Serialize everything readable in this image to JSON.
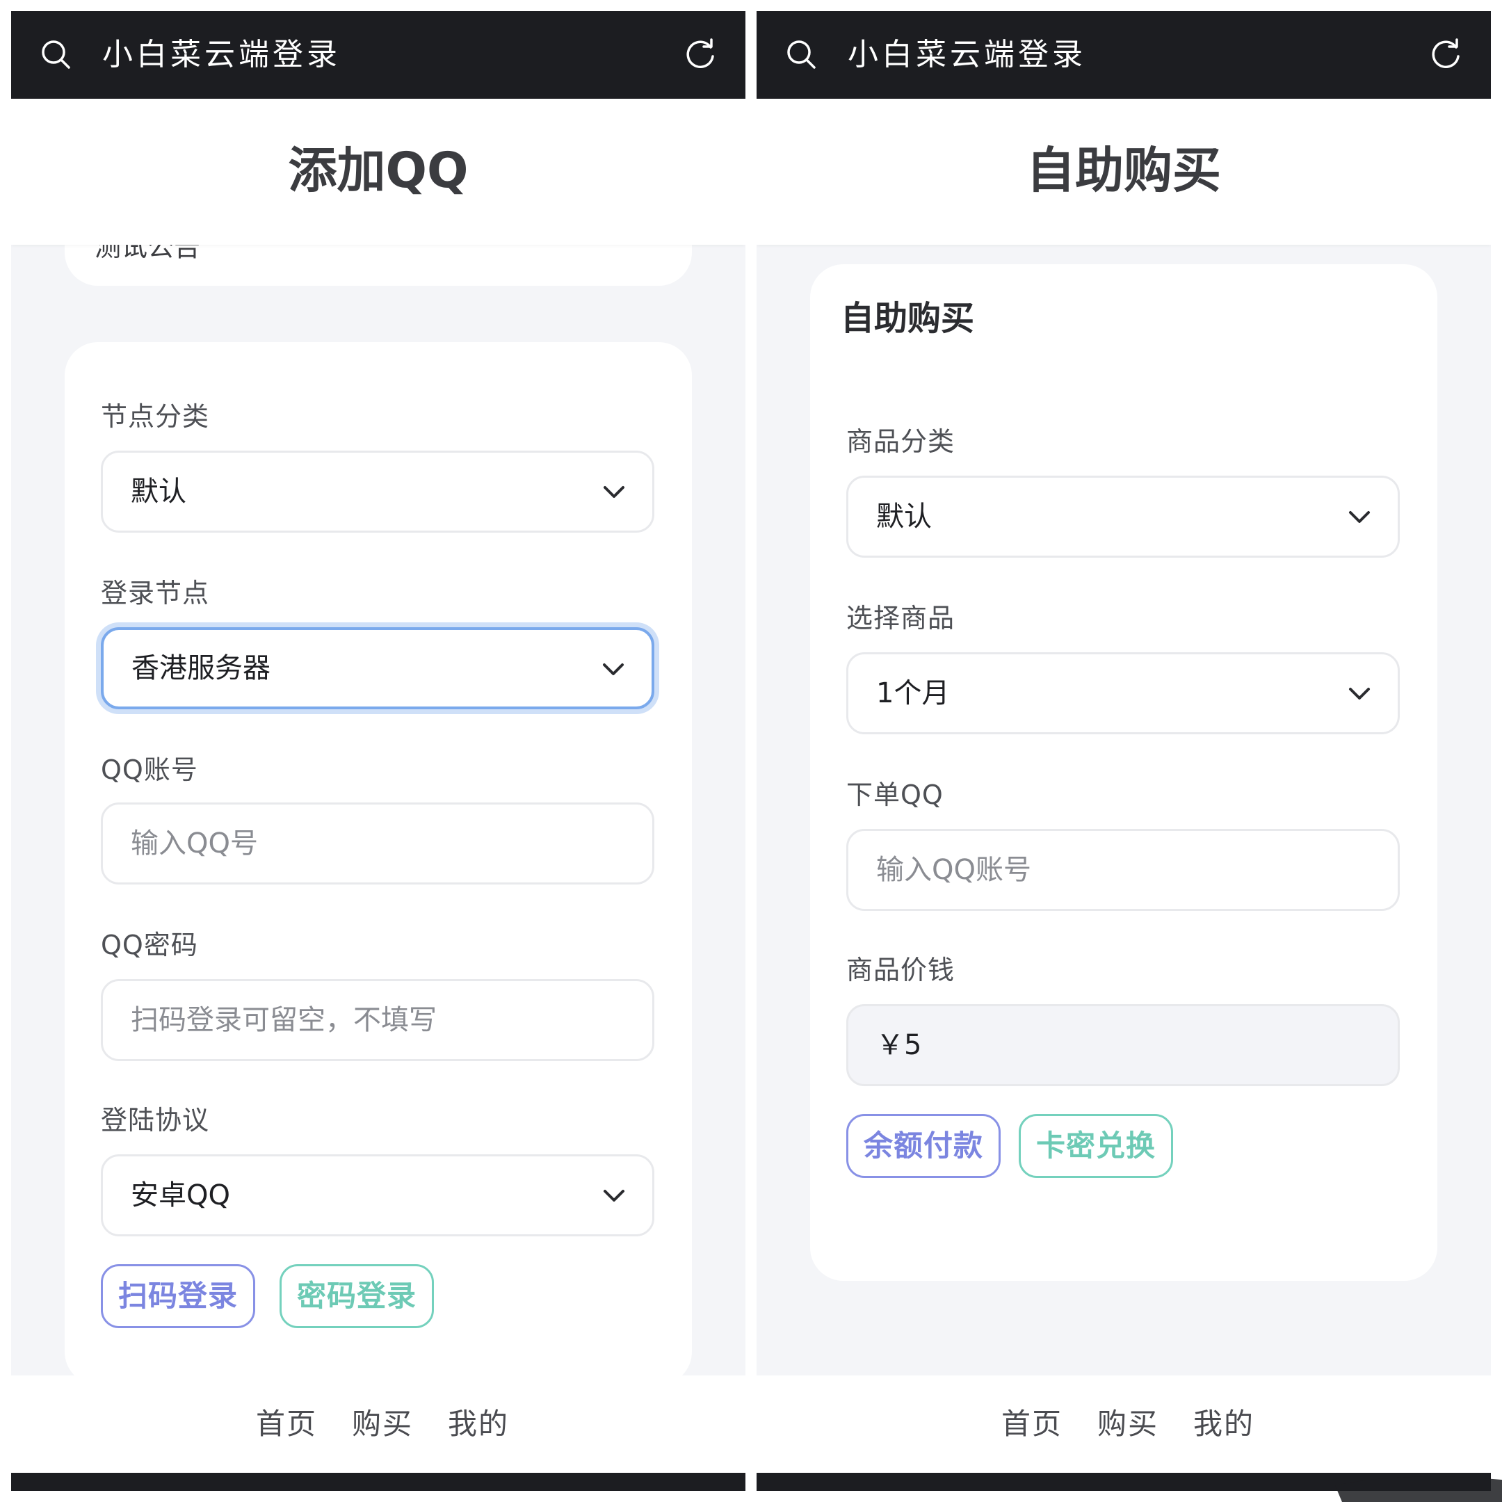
{
  "left_screen": {
    "topbar": {
      "app_title": "小白菜云端登录",
      "left_icon": "search-icon",
      "right_icon": "refresh-icon"
    },
    "header": {
      "title": "添加QQ"
    },
    "notice_card": {
      "partial_text": "测试公告"
    },
    "form": {
      "node_category": {
        "label": "节点分类",
        "value": "默认"
      },
      "login_node": {
        "label": "登录节点",
        "value": "香港服务器"
      },
      "qq_account": {
        "label": "QQ账号",
        "placeholder": "输入QQ号"
      },
      "qq_password": {
        "label": "QQ密码",
        "placeholder": "扫码登录可留空，不填写"
      },
      "login_protocol": {
        "label": "登陆协议",
        "value": "安卓QQ"
      },
      "buttons": {
        "scan_login": "扫码登录",
        "password_login": "密码登录"
      }
    },
    "tabbar": {
      "home": "首页",
      "buy": "购买",
      "mine": "我的"
    }
  },
  "right_screen": {
    "topbar": {
      "app_title": "小白菜云端登录",
      "left_icon": "search-icon",
      "right_icon": "refresh-icon"
    },
    "header": {
      "title": "自助购买"
    },
    "card": {
      "title": "自助购买",
      "product_category": {
        "label": "商品分类",
        "value": "默认"
      },
      "select_product": {
        "label": "选择商品",
        "value": "1个月"
      },
      "order_qq": {
        "label": "下单QQ",
        "placeholder": "输入QQ账号"
      },
      "price": {
        "label": "商品价钱",
        "value": "￥5"
      },
      "buttons": {
        "balance_pay": "余额付款",
        "card_redeem": "卡密兑换"
      }
    },
    "tabbar": {
      "home": "首页",
      "buy": "购买",
      "mine": "我的"
    }
  },
  "colors": {
    "topbar_bg": "#1c1d21",
    "page_bg": "#f4f5f8",
    "focus_border": "#7aa9ec",
    "purple_button": "#7b85e0",
    "teal_button": "#6dcab5"
  }
}
